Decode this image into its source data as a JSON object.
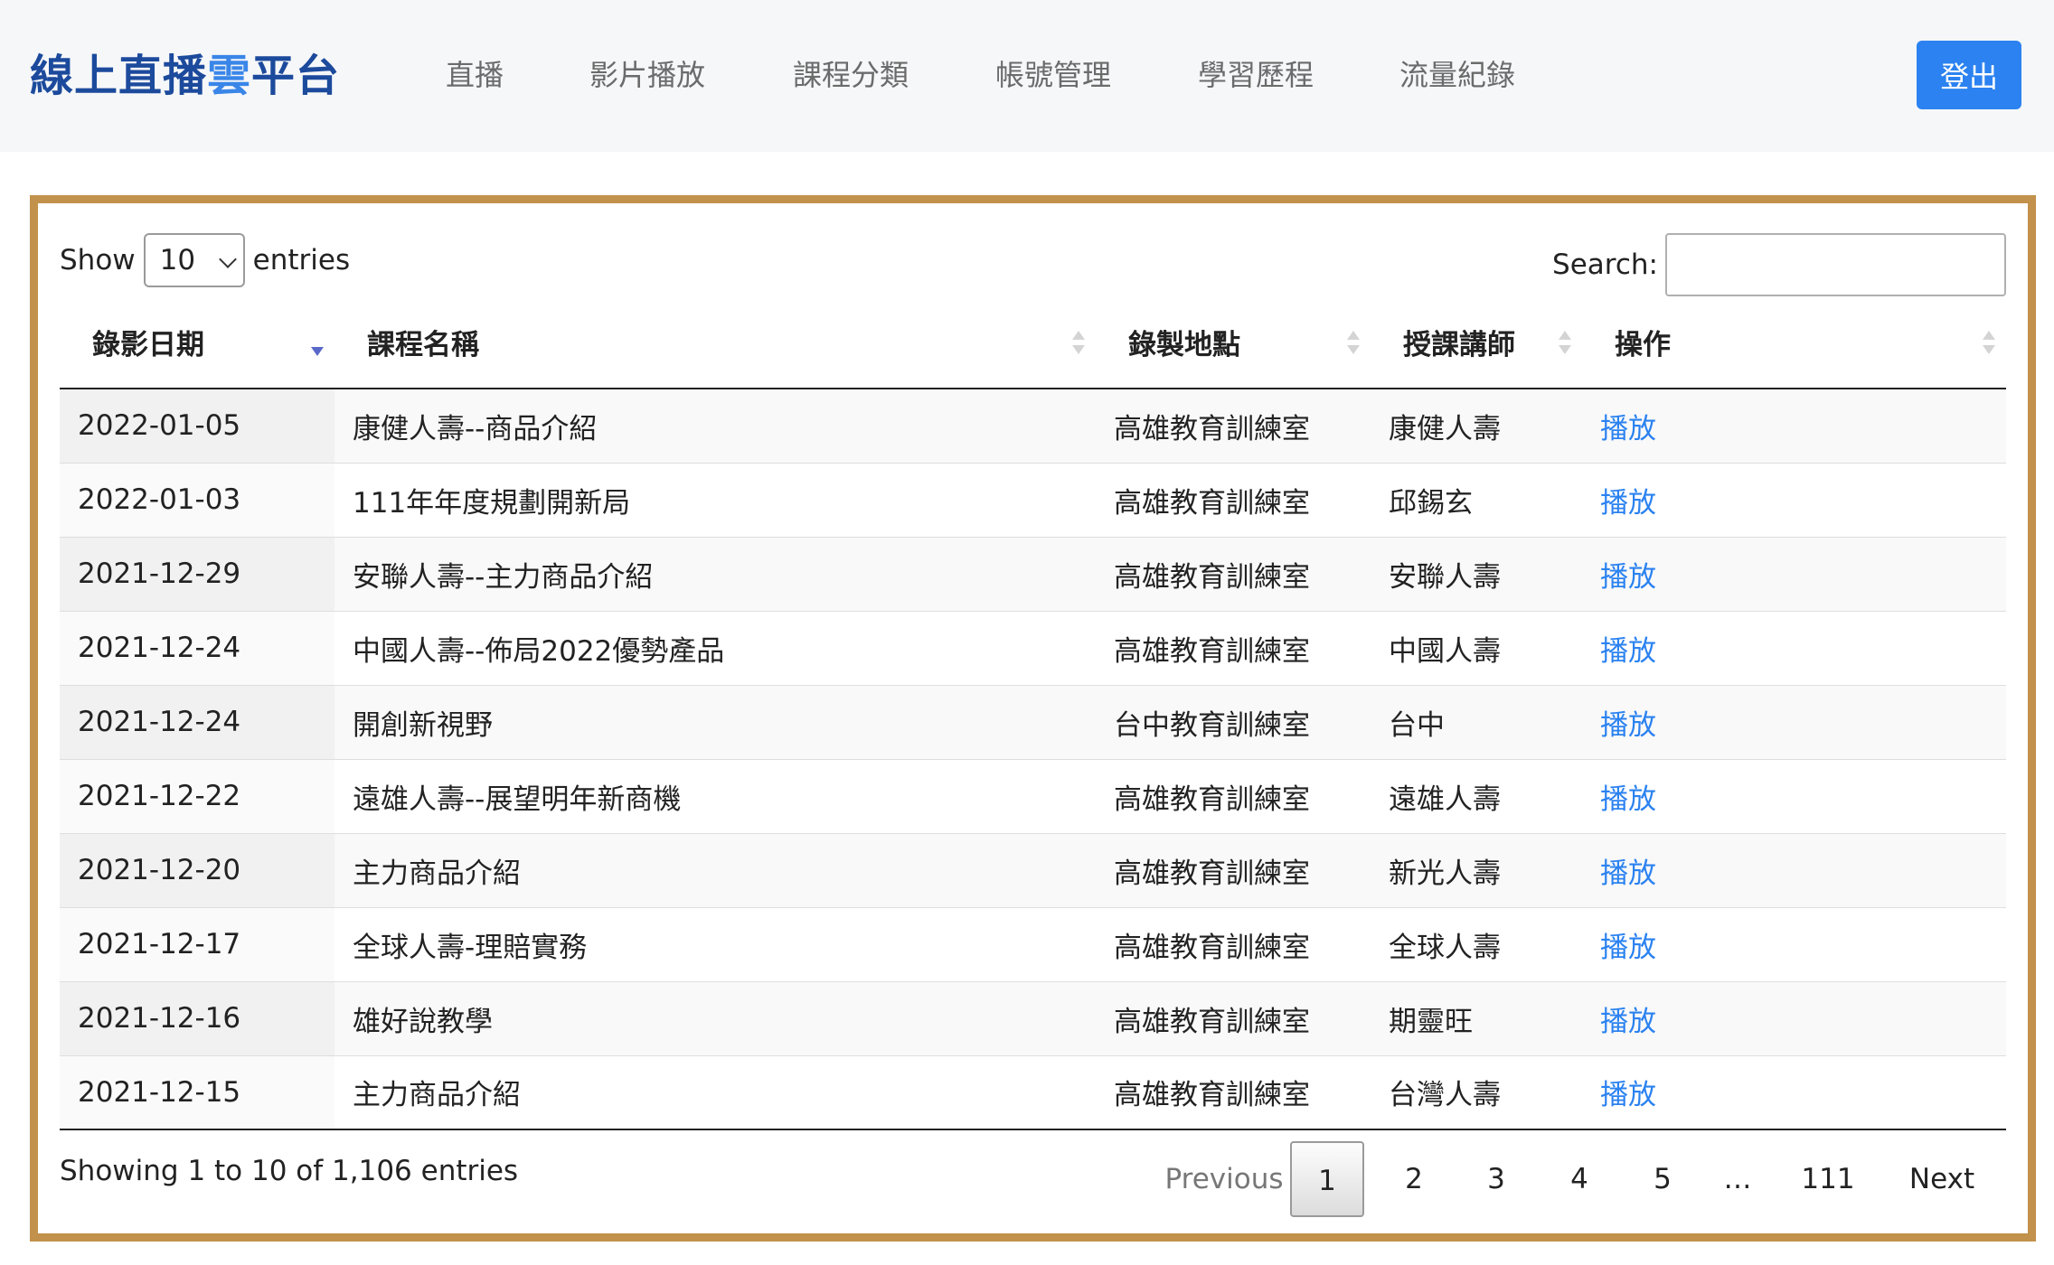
{
  "header": {
    "brand_main": "線上直播",
    "brand_accent": "雲",
    "brand_tail": "平台",
    "nav": [
      "直播",
      "影片播放",
      "課程分類",
      "帳號管理",
      "學習歷程",
      "流量紀錄"
    ],
    "logout_label": "登出"
  },
  "controls": {
    "show_label": "Show",
    "entries_label": "entries",
    "page_length": "10",
    "search_label": "Search:",
    "search_value": ""
  },
  "table": {
    "columns": [
      "錄影日期",
      "課程名稱",
      "錄製地點",
      "授課講師",
      "操作"
    ],
    "rows": [
      {
        "date": "2022-01-05",
        "course": "康健人壽--商品介紹",
        "location": "高雄教育訓練室",
        "teacher": "康健人壽",
        "action": "播放"
      },
      {
        "date": "2022-01-03",
        "course": "111年年度規劃開新局",
        "location": "高雄教育訓練室",
        "teacher": "邱錫玄",
        "action": "播放"
      },
      {
        "date": "2021-12-29",
        "course": "安聯人壽--主力商品介紹",
        "location": "高雄教育訓練室",
        "teacher": "安聯人壽",
        "action": "播放"
      },
      {
        "date": "2021-12-24",
        "course": "中國人壽--佈局2022優勢產品",
        "location": "高雄教育訓練室",
        "teacher": "中國人壽",
        "action": "播放"
      },
      {
        "date": "2021-12-24",
        "course": "開創新視野",
        "location": "台中教育訓練室",
        "teacher": "台中",
        "action": "播放"
      },
      {
        "date": "2021-12-22",
        "course": "遠雄人壽--展望明年新商機",
        "location": "高雄教育訓練室",
        "teacher": "遠雄人壽",
        "action": "播放"
      },
      {
        "date": "2021-12-20",
        "course": "主力商品介紹",
        "location": "高雄教育訓練室",
        "teacher": "新光人壽",
        "action": "播放"
      },
      {
        "date": "2021-12-17",
        "course": "全球人壽-理賠實務",
        "location": "高雄教育訓練室",
        "teacher": "全球人壽",
        "action": "播放"
      },
      {
        "date": "2021-12-16",
        "course": "雄好說教學",
        "location": "高雄教育訓練室",
        "teacher": "期靈旺",
        "action": "播放"
      },
      {
        "date": "2021-12-15",
        "course": "主力商品介紹",
        "location": "高雄教育訓練室",
        "teacher": "台灣人壽",
        "action": "播放"
      }
    ]
  },
  "footer": {
    "info": "Showing 1 to 10 of 1,106 entries",
    "previous": "Previous",
    "pages": [
      "1",
      "2",
      "3",
      "4",
      "5",
      "…",
      "111"
    ],
    "current_page": "1",
    "next": "Next"
  },
  "colors": {
    "brand": "#1c4a9c",
    "brand_accent": "#3a86e8",
    "primary": "#2b82f0",
    "panel_border": "#c2914b"
  }
}
